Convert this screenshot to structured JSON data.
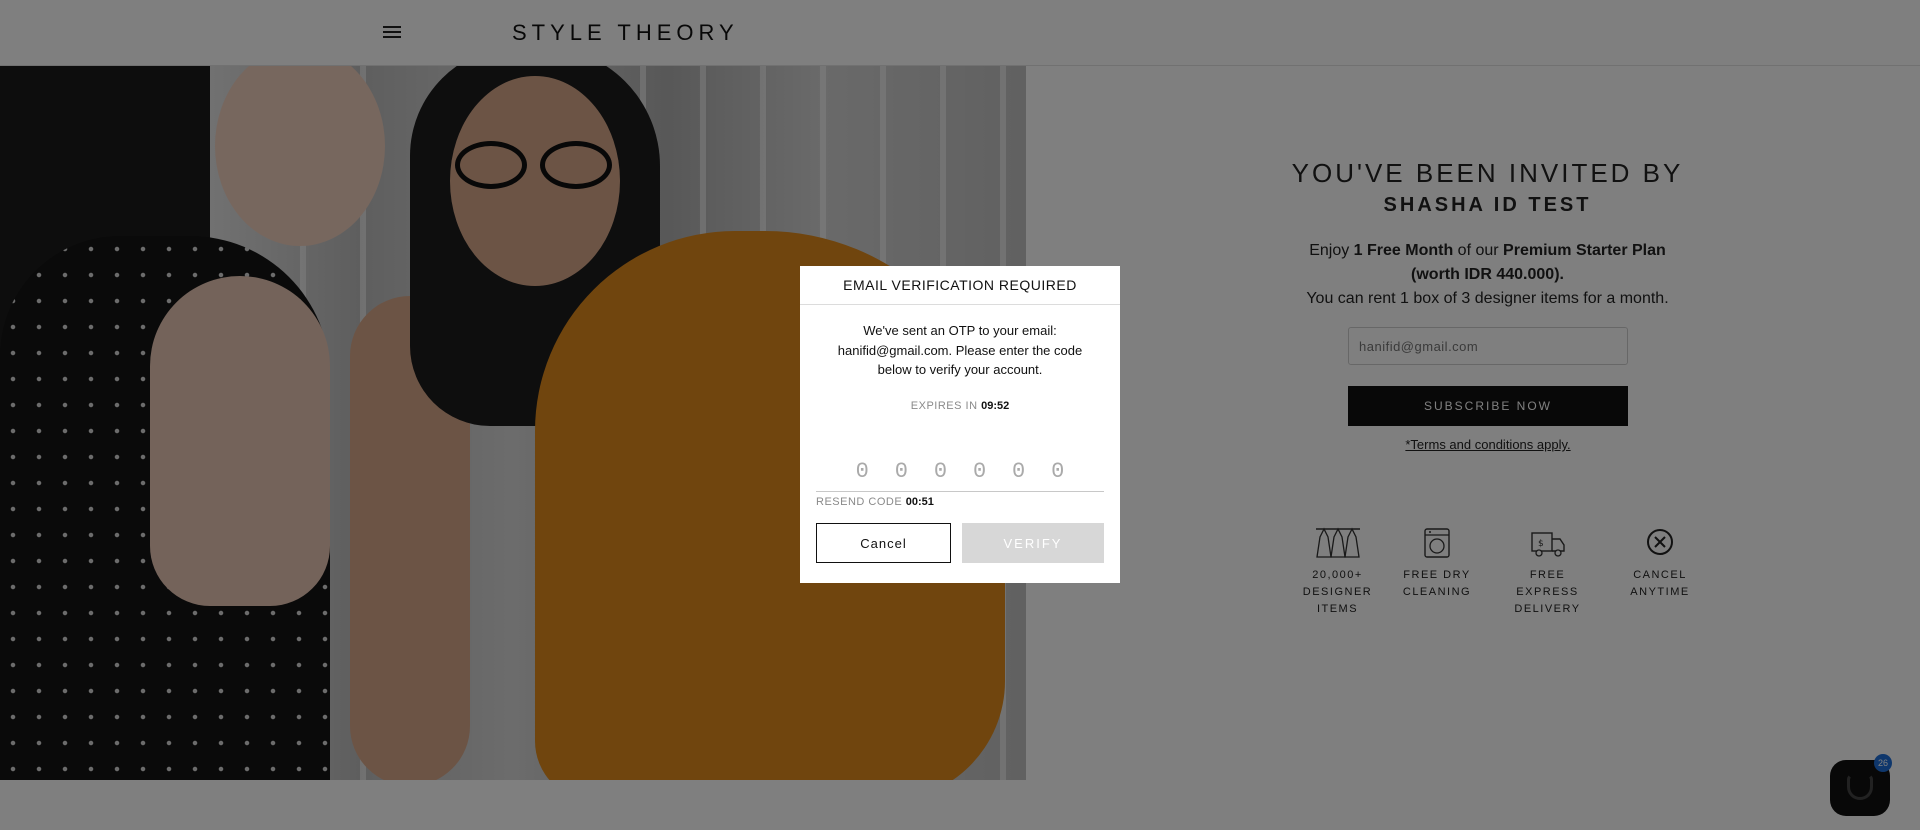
{
  "header": {
    "logo": "STYLE THEORY"
  },
  "invite": {
    "title": "YOU'VE BEEN INVITED BY",
    "name": "SHASHA ID TEST",
    "offer_prefix": "Enjoy ",
    "offer_bold_1": "1 Free Month",
    "offer_mid": " of our ",
    "offer_bold_2": "Premium Starter Plan (worth IDR 440.000).",
    "offer_line_2": "You can rent 1 box of 3 designer items for a month.",
    "email_placeholder": "hanifid@gmail.com",
    "subscribe_label": "SUBSCRIBE NOW",
    "terms_label": "*Terms and conditions apply."
  },
  "features": [
    {
      "icon": "dress-rack-icon",
      "line1": "20,000+",
      "line2": "DESIGNER ITEMS"
    },
    {
      "icon": "washing-machine-icon",
      "line1": "FREE DRY",
      "line2": "CLEANING"
    },
    {
      "icon": "delivery-truck-icon",
      "line1": "FREE EXPRESS",
      "line2": "DELIVERY"
    },
    {
      "icon": "cancel-circle-icon",
      "line1": "CANCEL",
      "line2": "ANYTIME"
    }
  ],
  "chat": {
    "badge_count": "26"
  },
  "modal": {
    "title": "EMAIL VERIFICATION REQUIRED",
    "message": "We've sent an OTP to your email: hanifid@gmail.com. Please enter the code below to verify your account.",
    "expires_label": "EXPIRES IN ",
    "expires_value": "09:52",
    "otp_placeholders": [
      "0",
      "0",
      "0",
      "0",
      "0",
      "0"
    ],
    "resend_label": "RESEND CODE ",
    "resend_value": "00:51",
    "cancel_label": "Cancel",
    "verify_label": "VERIFY"
  },
  "colors": {
    "overlay": "#000000",
    "button_dark": "#111111",
    "verify_disabled": "#d7d7d7",
    "badge_blue": "#1e6fd9",
    "dress_orange": "#e08a1c"
  }
}
